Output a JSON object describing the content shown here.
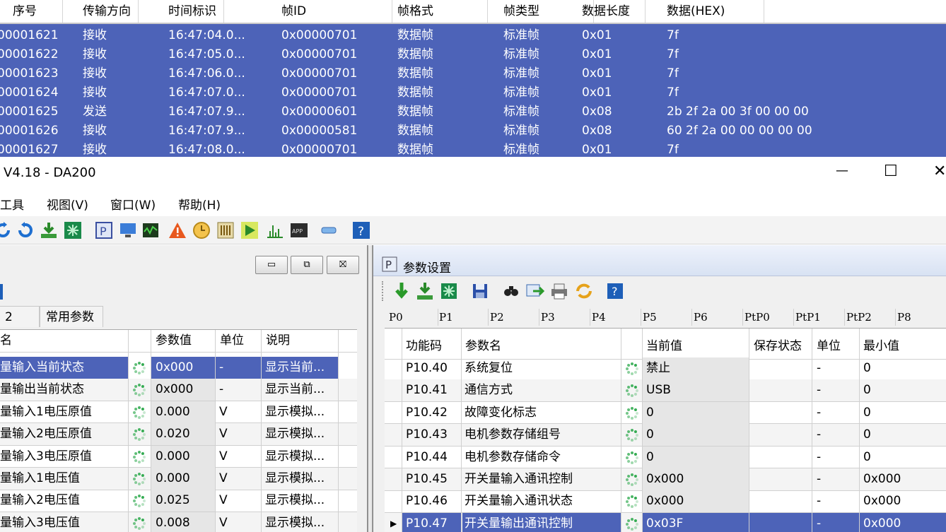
{
  "can_log": {
    "columns": [
      "序号",
      "传输方向",
      "时间标识",
      "帧ID",
      "帧格式",
      "帧类型",
      "数据长度",
      "数据(HEX)"
    ],
    "rows": [
      [
        "00001621",
        "接收",
        "16:47:04.0...",
        "0x00000701",
        "数据帧",
        "标准帧",
        "0x01",
        "7f"
      ],
      [
        "00001622",
        "接收",
        "16:47:05.0...",
        "0x00000701",
        "数据帧",
        "标准帧",
        "0x01",
        "7f"
      ],
      [
        "00001623",
        "接收",
        "16:47:06.0...",
        "0x00000701",
        "数据帧",
        "标准帧",
        "0x01",
        "7f"
      ],
      [
        "00001624",
        "接收",
        "16:47:07.0...",
        "0x00000701",
        "数据帧",
        "标准帧",
        "0x01",
        "7f"
      ],
      [
        "00001625",
        "发送",
        "16:47:07.9...",
        "0x00000601",
        "数据帧",
        "标准帧",
        "0x08",
        "2b 2f 2a 00 3f 00 00 00"
      ],
      [
        "00001626",
        "接收",
        "16:47:07.9...",
        "0x00000581",
        "数据帧",
        "标准帧",
        "0x08",
        "60 2f 2a 00 00 00 00 00"
      ],
      [
        "00001627",
        "接收",
        "16:47:08.0...",
        "0x00000701",
        "数据帧",
        "标准帧",
        "0x01",
        "7f"
      ]
    ]
  },
  "window": {
    "title": "V4.18 - DA200",
    "minimize_glyph": "—",
    "maximize_glyph": "☐",
    "close_glyph": "✕"
  },
  "menu": [
    "工具",
    "视图(V)",
    "窗口(W)",
    "帮助(H)"
  ],
  "left_pane": {
    "mdi_buttons": [
      "▭",
      "⧉",
      "⛝"
    ],
    "tabs": [
      "2",
      "常用参数"
    ],
    "columns": [
      "名",
      "参数值",
      "单位",
      "说明"
    ],
    "rows": [
      {
        "name": "量输入当前状态",
        "value": "0x000",
        "unit": "-",
        "desc": "显示当前..."
      },
      {
        "name": "量输出当前状态",
        "value": "0x000",
        "unit": "-",
        "desc": "显示当前..."
      },
      {
        "name": "量输入1电压原值",
        "value": "0.000",
        "unit": "V",
        "desc": "显示模拟..."
      },
      {
        "name": "量输入2电压原值",
        "value": "0.020",
        "unit": "V",
        "desc": "显示模拟..."
      },
      {
        "name": "量输入3电压原值",
        "value": "0.000",
        "unit": "V",
        "desc": "显示模拟..."
      },
      {
        "name": "量输入1电压值",
        "value": "0.000",
        "unit": "V",
        "desc": "显示模拟..."
      },
      {
        "name": "量输入2电压值",
        "value": "0.025",
        "unit": "V",
        "desc": "显示模拟..."
      },
      {
        "name": "量输入3电压值",
        "value": "0.008",
        "unit": "V",
        "desc": "显示模拟..."
      }
    ]
  },
  "right_pane": {
    "title": "参数设置",
    "title_icon_letter": "P",
    "help_glyph": "?",
    "tabs": [
      "P0",
      "P1",
      "P2",
      "P3",
      "P4",
      "P5",
      "P6",
      "PtP0",
      "PtP1",
      "PtP2",
      "P8"
    ],
    "columns": [
      "功能码",
      "参数名",
      "当前值",
      "保存状态",
      "单位",
      "最小值"
    ],
    "rows": [
      {
        "code": "P10.40",
        "name": "系统复位",
        "value": "禁止",
        "save": "",
        "unit": "-",
        "min": "0"
      },
      {
        "code": "P10.41",
        "name": "通信方式",
        "value": "USB",
        "save": "",
        "unit": "-",
        "min": "0"
      },
      {
        "code": "P10.42",
        "name": "故障变化标志",
        "value": "0",
        "save": "",
        "unit": "-",
        "min": "0"
      },
      {
        "code": "P10.43",
        "name": "电机参数存储组号",
        "value": "0",
        "save": "",
        "unit": "-",
        "min": "0"
      },
      {
        "code": "P10.44",
        "name": "电机参数存储命令",
        "value": "0",
        "save": "",
        "unit": "-",
        "min": "0"
      },
      {
        "code": "P10.45",
        "name": "开关量输入通讯控制",
        "value": "0x000",
        "save": "",
        "unit": "-",
        "min": "0x000"
      },
      {
        "code": "P10.46",
        "name": "开关量输入通讯状态",
        "value": "0x000",
        "save": "",
        "unit": "-",
        "min": "0x000"
      },
      {
        "code": "P10.47",
        "name": "开关量输出通讯控制",
        "value": "0x03F",
        "save": "",
        "unit": "-",
        "min": "0x000"
      }
    ]
  },
  "colors": {
    "selection": "#4d63b8",
    "spinner": "#2aa84a"
  }
}
